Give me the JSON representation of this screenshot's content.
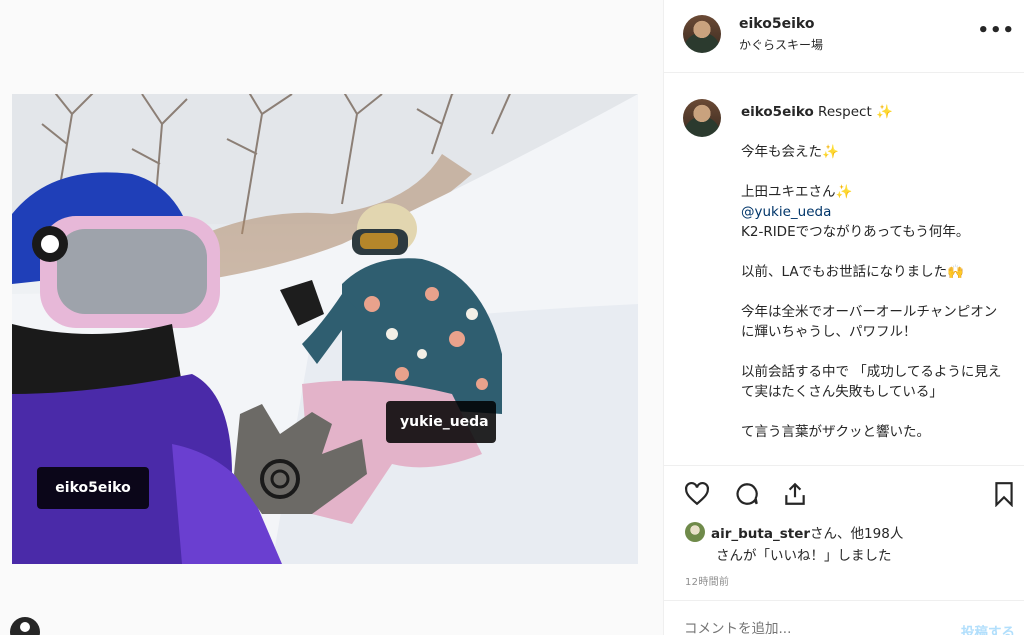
{
  "post": {
    "author": "eiko5eiko",
    "location": "かぐらスキー場",
    "menu_icon": "more-dots-icon",
    "tags": [
      "eiko5eiko",
      "yukie_ueda"
    ],
    "caption": {
      "user": "eiko5eiko",
      "first_line": "Respect ✨",
      "lines": [
        "",
        "今年も会えた✨",
        "",
        "上田ユキエさん✨",
        "@yukie_ueda",
        "K2-RIDEでつながりあってもう何年。",
        "",
        "以前、LAでもお世話になりました🙌",
        "",
        "今年は全米でオーバーオールチャンピオン",
        "に輝いちゃうし、パワフル！",
        "",
        "以前会話する中で 「成功してるように見え",
        "て実はたくさん失敗もしている」",
        "",
        "て言う言葉がザクッと響いた。"
      ]
    },
    "likes": {
      "user": "air_buta_ster",
      "suffix": "さん、他198人",
      "line2": "さんが「いいね！」しました"
    },
    "timestamp": "12時間前",
    "comment_placeholder": "コメントを追加...",
    "post_label": "投稿する"
  },
  "colors": {
    "mention": "#003569",
    "post_button": "#b2dffc",
    "muted": "#8e8e8e"
  }
}
